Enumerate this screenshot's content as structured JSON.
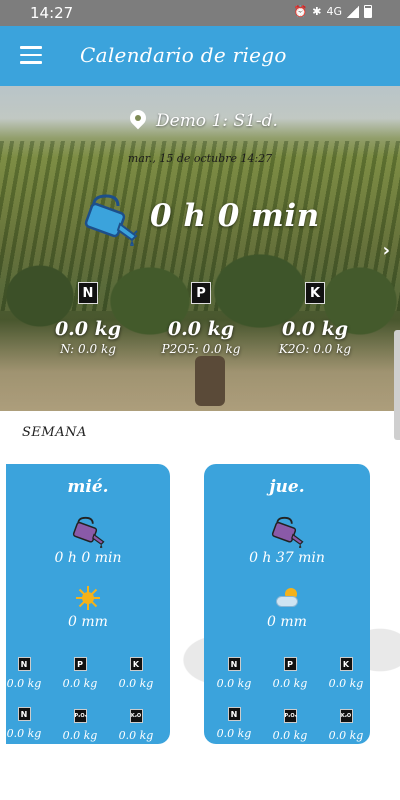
{
  "status": {
    "time": "14:27",
    "net": "4G"
  },
  "appbar": {
    "title": "Calendario de riego"
  },
  "hero": {
    "location": "Demo 1: S1-d.",
    "date": "mar., 15 de octubre 14:27",
    "duration": "0 h 0 min",
    "nutrients": [
      {
        "badge": "N",
        "total": "0.0 kg",
        "detail": "N: 0.0 kg"
      },
      {
        "badge": "P",
        "total": "0.0 kg",
        "detail": "P2O5: 0.0 kg"
      },
      {
        "badge": "K",
        "total": "0.0 kg",
        "detail": "K2O: 0.0 kg"
      }
    ]
  },
  "week": {
    "label": "SEMANA",
    "days": [
      {
        "day": "mié.",
        "time": "0 h 0 min",
        "weather_icon": "sun-icon",
        "rain": "0 mm",
        "row1": [
          {
            "badge": "N",
            "value": "0.0 kg"
          },
          {
            "badge": "P",
            "value": "0.0 kg"
          },
          {
            "badge": "K",
            "value": "0.0 kg"
          }
        ],
        "row2": [
          {
            "badge": "N",
            "value": "0.0 kg"
          },
          {
            "badge": "P₂O₅",
            "value": "0.0 kg"
          },
          {
            "badge": "K₂O",
            "value": "0.0 kg"
          }
        ]
      },
      {
        "day": "jue.",
        "time": "0 h 37 min",
        "weather_icon": "cloud-sun-icon",
        "rain": "0 mm",
        "row1": [
          {
            "badge": "N",
            "value": "0.0 kg"
          },
          {
            "badge": "P",
            "value": "0.0 kg"
          },
          {
            "badge": "K",
            "value": "0.0 kg"
          }
        ],
        "row2": [
          {
            "badge": "N",
            "value": "0.0 kg"
          },
          {
            "badge": "P₂O₅",
            "value": "0.0 kg"
          },
          {
            "badge": "K₂O",
            "value": "0.0 kg"
          }
        ]
      }
    ]
  },
  "colors": {
    "primary": "#3ba3dc",
    "statusbar": "#7d7d7d",
    "sun": "#f4b21a"
  }
}
